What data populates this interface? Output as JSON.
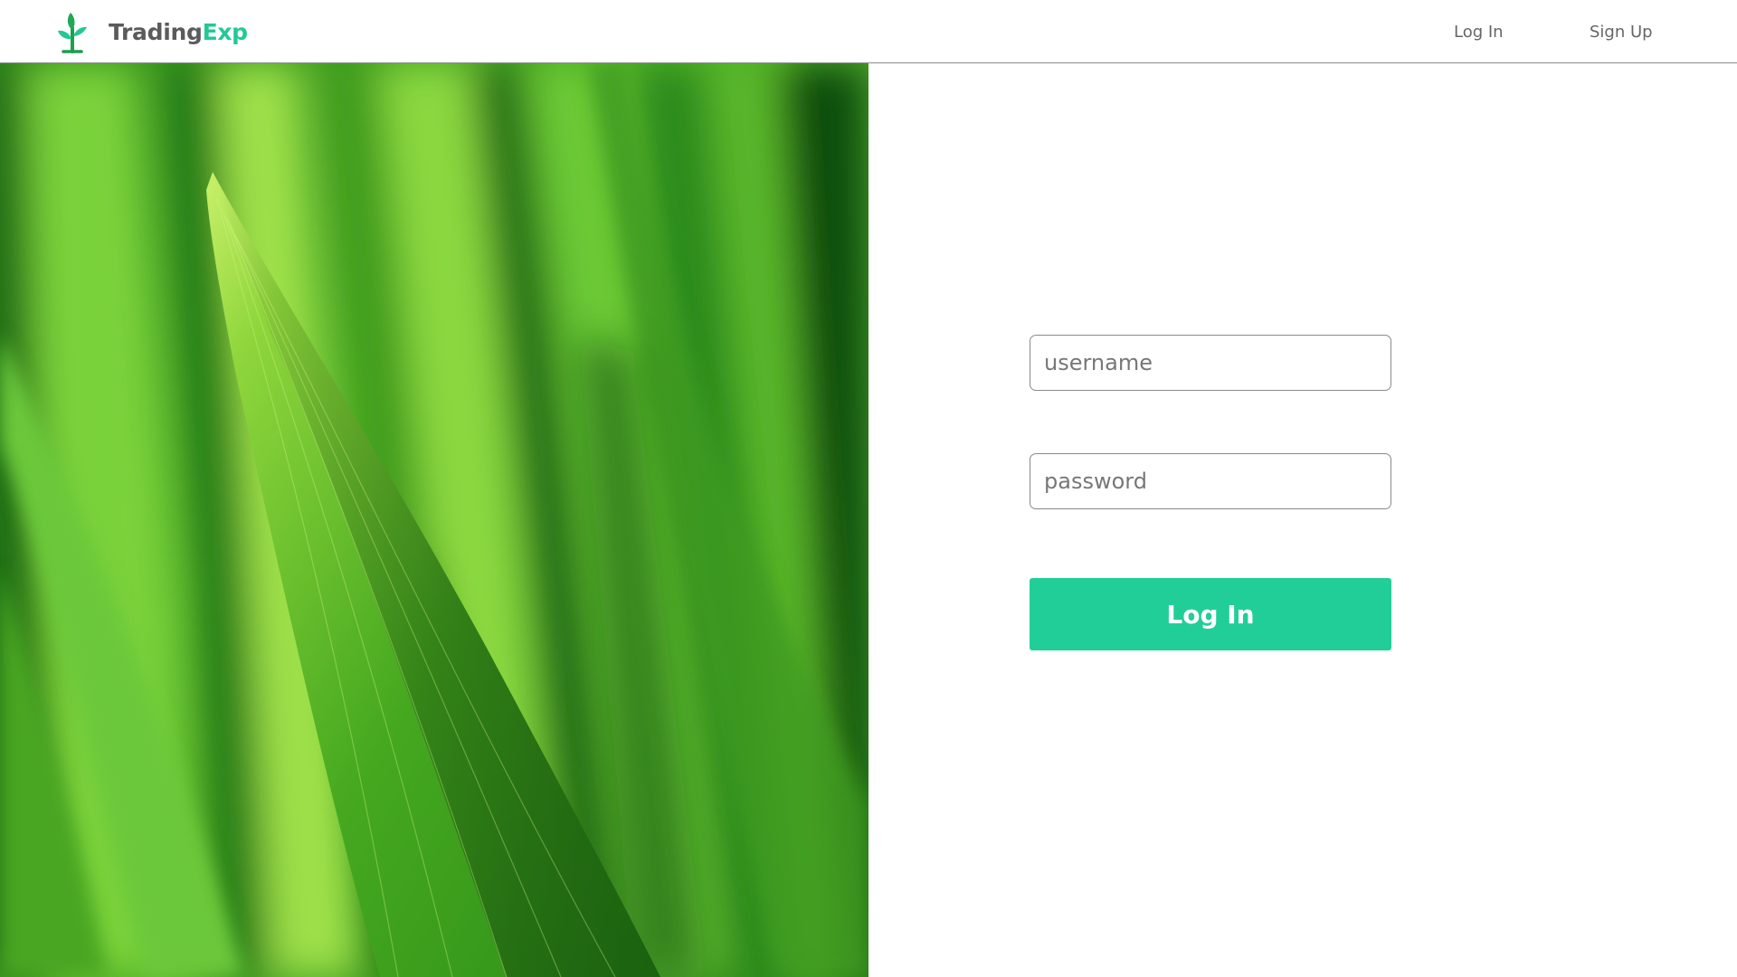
{
  "header": {
    "brand_part1": "Trading",
    "brand_part2": "Exp",
    "logo_icon": "sprout-icon",
    "nav": {
      "login_label": "Log In",
      "signup_label": "Sign Up"
    }
  },
  "hero": {
    "image": "green-grass-blade-photo"
  },
  "form": {
    "username_placeholder": "username",
    "password_placeholder": "password",
    "submit_label": "Log In"
  },
  "colors": {
    "accent": "#22ce97",
    "brand_text": "#5b5b5b",
    "border": "#8a8a8a"
  }
}
